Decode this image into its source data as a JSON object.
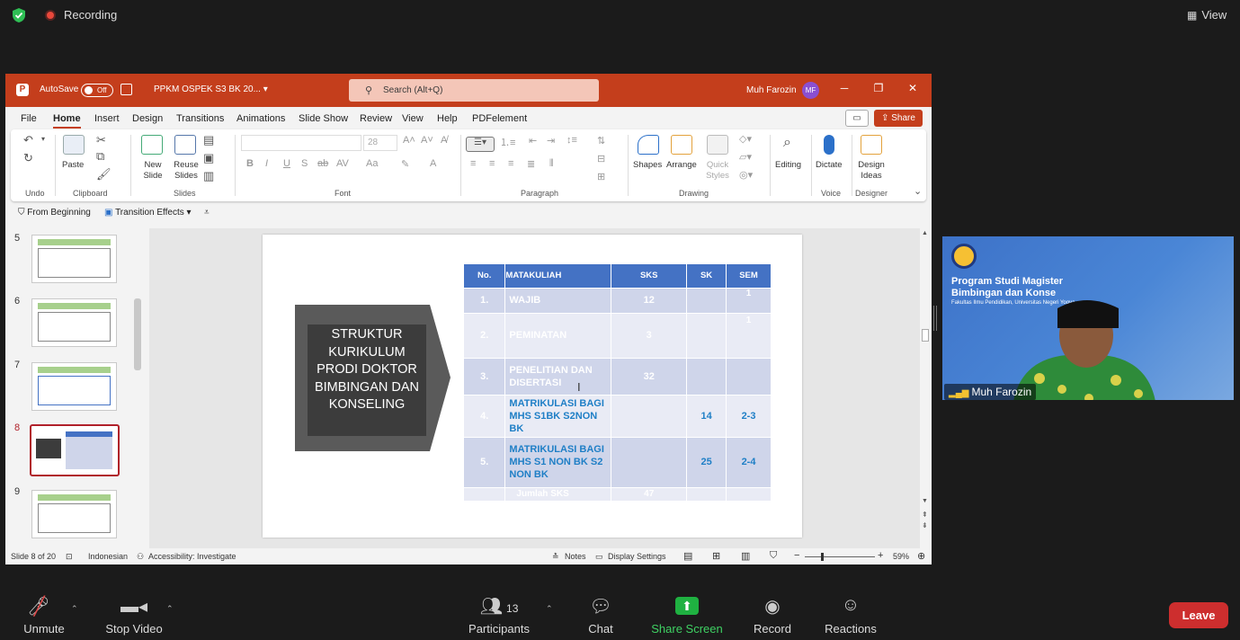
{
  "zoom": {
    "recording_label": "Recording",
    "view_label": "View",
    "toolbar": {
      "unmute": "Unmute",
      "stop_video": "Stop Video",
      "participants": "Participants",
      "participants_count": "13",
      "chat": "Chat",
      "share_screen": "Share Screen",
      "record": "Record",
      "reactions": "Reactions",
      "leave": "Leave"
    },
    "video_tile": {
      "name": "Muh Farozin",
      "title_line1": "Program Studi Magister",
      "title_line2": "Bimbingan dan Konse",
      "subtitle": "Fakultas Ilmu Pendidikan, Universitas Negeri Yogya"
    },
    "colors": {
      "leave": "#cd2e2e",
      "share": "#1fb141",
      "recording": "#e8483b"
    }
  },
  "ppt": {
    "autosave_label": "AutoSave",
    "autosave_state": "Off",
    "doc_title": "PPKM OSPEK S3 BK 20...",
    "search_placeholder": "Search (Alt+Q)",
    "user_name": "Muh Farozin",
    "user_initials": "MF",
    "tabs": [
      "File",
      "Home",
      "Insert",
      "Design",
      "Transitions",
      "Animations",
      "Slide Show",
      "Review",
      "View",
      "Help",
      "PDFelement"
    ],
    "share_label": "Share",
    "ribbon": {
      "undo_group": "Undo",
      "paste": "Paste",
      "clipboard_group": "Clipboard",
      "new_slide": "New Slide",
      "reuse_slides": "Reuse Slides",
      "slides_group": "Slides",
      "font_size": "28",
      "font_group": "Font",
      "paragraph_group": "Paragraph",
      "shapes": "Shapes",
      "arrange": "Arrange",
      "quick_styles": "Quick Styles",
      "drawing_group": "Drawing",
      "editing": "Editing",
      "dictate": "Dictate",
      "voice_group": "Voice",
      "design_ideas": "Design Ideas",
      "designer_group": "Designer"
    },
    "qat": {
      "from_beginning": "From Beginning",
      "transition_effects": "Transition Effects"
    },
    "thumbnails": [
      "5",
      "6",
      "7",
      "8",
      "9"
    ],
    "slide": {
      "chevron_text": "STRUKTUR KURIKULUM PRODI DOKTOR BIMBINGAN DAN KONSELING",
      "headers": {
        "no": "No.",
        "matakuliah": "MATAKULIAH",
        "sks": "SKS",
        "sk": "SK",
        "sem": "SEM"
      },
      "rows": [
        {
          "no": "1.",
          "mk": "WAJIB",
          "sks": "12",
          "sk": "",
          "sem": "1"
        },
        {
          "no": "2.",
          "mk": "PEMINATAN",
          "sks": "3",
          "sk": "",
          "sem": "1"
        },
        {
          "no": "3.",
          "mk": "PENELITIAN DAN DISERTASI",
          "sks": "32",
          "sk": "",
          "sem": ""
        },
        {
          "no": "4.",
          "mk": "MATRIKULASI BAGI MHS S1BK S2NON BK",
          "sks": "",
          "sk": "14",
          "sem": "2-3"
        },
        {
          "no": "5.",
          "mk": "MATRIKULASI BAGI MHS S1 NON BK S2 NON BK",
          "sks": "",
          "sk": "25",
          "sem": "2-4"
        }
      ],
      "total_label": "Jumlah SKS",
      "total_value": "47"
    },
    "status": {
      "slide_of": "Slide 8 of 20",
      "language": "Indonesian",
      "accessibility": "Accessibility: Investigate",
      "notes": "Notes",
      "display_settings": "Display Settings",
      "zoom": "59%"
    }
  }
}
